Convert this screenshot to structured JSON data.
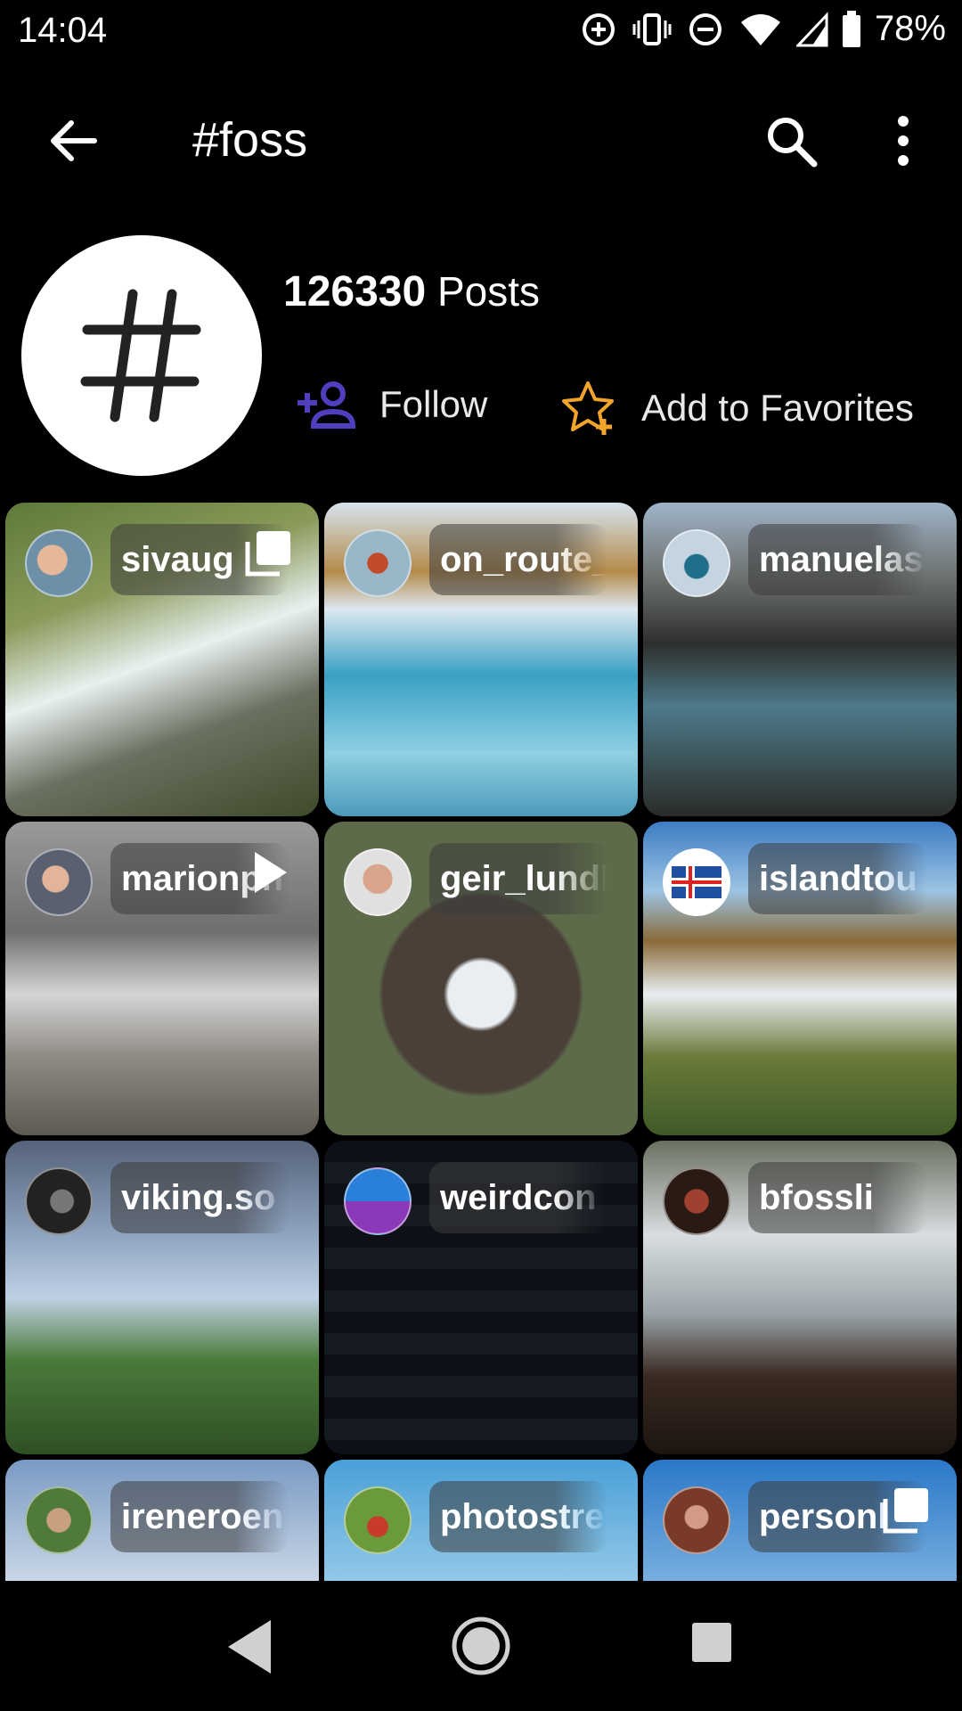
{
  "status": {
    "time": "14:04",
    "battery": "78%"
  },
  "appbar": {
    "title": "#foss"
  },
  "tag": {
    "post_count": "126330",
    "posts_label": "Posts",
    "follow_label": "Follow",
    "favorites_label": "Add to Favorites"
  },
  "colors": {
    "follow_icon": "#4f3fbf",
    "favorites_icon": "#f2a52a"
  },
  "posts": [
    {
      "username": "sivaug",
      "badge": "multi-image"
    },
    {
      "username": "on_route_",
      "badge": "none"
    },
    {
      "username": "manuelas",
      "badge": "none"
    },
    {
      "username": "marionph",
      "badge": "video"
    },
    {
      "username": "geir_lundl",
      "badge": "none"
    },
    {
      "username": "islandtou",
      "badge": "none"
    },
    {
      "username": "viking.so",
      "badge": "none"
    },
    {
      "username": "weirdcon",
      "badge": "none"
    },
    {
      "username": "bfossli",
      "badge": "none"
    },
    {
      "username": "ireneroen",
      "badge": "none"
    },
    {
      "username": "photostre",
      "badge": "none"
    },
    {
      "username": "personl",
      "badge": "multi-image"
    }
  ]
}
